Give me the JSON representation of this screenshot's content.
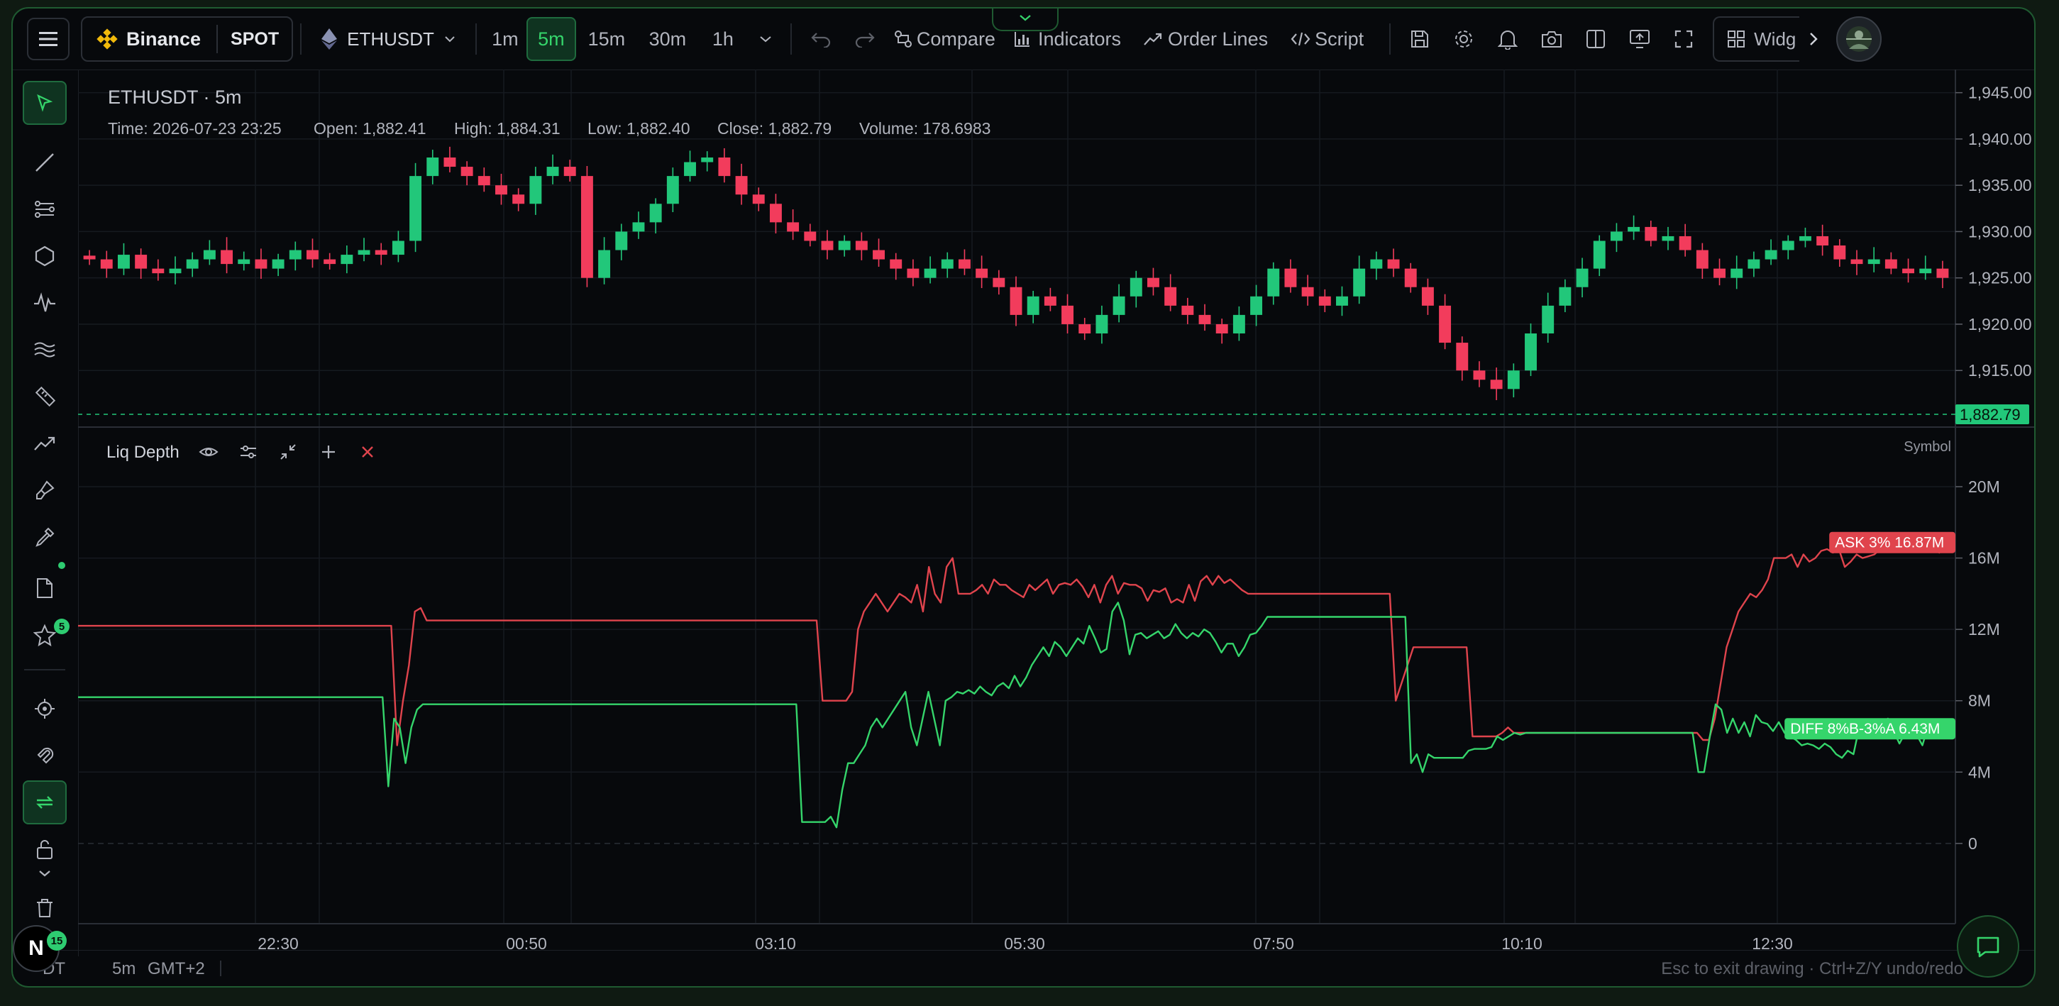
{
  "topbar": {
    "exchange": "Binance",
    "market": "SPOT",
    "symbol": "ETHUSDT",
    "timeframes": [
      "1m",
      "5m",
      "15m",
      "30m",
      "1h"
    ],
    "active_timeframe": "5m",
    "compare": "Compare",
    "indicators": "Indicators",
    "order_lines": "Order Lines",
    "script": "Script",
    "widgets": "Widg"
  },
  "legend": {
    "title": "ETHUSDT · 5m",
    "time": "Time: 2026-07-23 23:25",
    "open": "Open: 1,882.41",
    "high": "High: 1,884.31",
    "low": "Low: 1,882.40",
    "close": "Close: 1,882.79",
    "volume": "Volume: 178.6983"
  },
  "indicator": {
    "name": "Liq Depth",
    "symbol_label": "Symbol"
  },
  "left_toolbar": {
    "favorites_badge": "5",
    "notifications_badge": "15",
    "user_initial": "N"
  },
  "status": {
    "symbol_fragment": "DT",
    "interval": "5m",
    "timezone": "GMT+2",
    "hint": "Esc to exit drawing · Ctrl+Z/Y undo/redo"
  },
  "colors": {
    "up": "#22c77a",
    "down": "#f23c5c",
    "ask": "#e0444d",
    "diff": "#35d56b",
    "accent": "#2ecc71"
  },
  "chart_data": [
    {
      "type": "candlestick",
      "title": "ETHUSDT · 5m",
      "y_axis_ticks": [
        "1,945.00",
        "1,940.00",
        "1,935.00",
        "1,930.00",
        "1,925.00",
        "1,920.00",
        "1,915.00"
      ],
      "ylim": [
        1909.5,
        1947.5
      ],
      "x_ticks": [
        "22:30",
        "00:50",
        "03:10",
        "05:30",
        "07:50",
        "10:10",
        "12:30"
      ],
      "last_price": 1882.79,
      "last_price_label": "1,882.79",
      "close_path": [
        1927,
        1926,
        1927.5,
        1926,
        1925.5,
        1926,
        1927,
        1928,
        1926.5,
        1927,
        1926,
        1927,
        1928,
        1927,
        1926.5,
        1927.5,
        1928,
        1927.5,
        1929,
        1936,
        1938,
        1937,
        1936,
        1935,
        1934,
        1933,
        1936,
        1937,
        1936,
        1925,
        1928,
        1930,
        1931,
        1933,
        1936,
        1937.5,
        1938,
        1936,
        1934,
        1933,
        1931,
        1930,
        1929,
        1928,
        1929,
        1928,
        1927,
        1926,
        1925,
        1926,
        1927,
        1926,
        1925,
        1924,
        1921,
        1923,
        1922,
        1920,
        1919,
        1921,
        1923,
        1925,
        1924,
        1922,
        1921,
        1920,
        1919,
        1921,
        1923,
        1926,
        1924,
        1923,
        1922,
        1923,
        1926,
        1927,
        1926,
        1924,
        1922,
        1918,
        1915,
        1914,
        1913,
        1915,
        1919,
        1922,
        1924,
        1926,
        1929,
        1930,
        1930.5,
        1929,
        1929.5,
        1928,
        1926,
        1925,
        1926,
        1927,
        1928,
        1929,
        1929.5,
        1928.5,
        1927,
        1926.5,
        1927,
        1926,
        1925.5,
        1926,
        1925
      ]
    },
    {
      "type": "line",
      "title": "Liq Depth",
      "y_axis_ticks": [
        "20M",
        "16M",
        "12M",
        "8M",
        "4M",
        "0"
      ],
      "ylim": [
        -4.5,
        23.5
      ],
      "series": [
        {
          "name": "ASK 3%",
          "last_value_label": "ASK 3% 16.87M",
          "values": [
            12.2,
            12.2,
            12.2,
            12.2,
            12.2,
            12.2,
            12.2,
            12.2,
            12.2,
            12.2,
            12.2,
            12.2,
            12.2,
            12.2,
            12.2,
            12.2,
            12.2,
            12.2,
            12.2,
            12.2,
            12.2,
            12.2,
            12.2,
            12.2,
            12.2,
            12.2,
            12.2,
            12.2,
            12.2,
            12.2,
            12.2,
            12.2,
            12.2,
            12.2,
            12.2,
            12.2,
            12.2,
            12.2,
            12.2,
            12.2,
            12.2,
            12.2,
            12.2,
            12.2,
            12.2,
            12.2,
            12.2,
            12.2,
            12.2,
            12.2,
            12.2,
            12.2,
            12.2,
            12.2,
            5.5,
            8,
            10,
            13,
            13.2,
            12.5,
            12.5,
            12.5,
            12.5,
            12.5,
            12.5,
            12.5,
            12.5,
            12.5,
            12.5,
            12.5,
            12.5,
            12.5,
            12.5,
            12.5,
            12.5,
            12.5,
            12.5,
            12.5,
            12.5,
            12.5,
            12.5,
            12.5,
            12.5,
            12.5,
            12.5,
            12.5,
            12.5,
            12.5,
            12.5,
            12.5,
            12.5,
            12.5,
            12.5,
            12.5,
            12.5,
            12.5,
            12.5,
            12.5,
            12.5,
            12.5,
            12.5,
            12.5,
            12.5,
            12.5,
            12.5,
            12.5,
            12.5,
            12.5,
            12.5,
            12.5,
            12.5,
            12.5,
            12.5,
            12.5,
            12.5,
            12.5,
            12.5,
            12.5,
            12.5,
            12.5,
            12.5,
            12.5,
            12.5,
            12.5,
            12.5,
            12.5,
            8,
            8,
            8,
            8,
            8,
            8.5,
            12,
            13,
            13.5,
            14,
            13.5,
            13,
            13.5,
            14,
            13.8,
            13.5,
            14.5,
            13,
            15.5,
            14,
            13.5,
            15.5,
            16,
            14,
            14,
            14,
            14.2,
            14.5,
            14,
            14.8,
            14.5,
            14.5,
            14.2,
            14,
            13.8,
            14.5,
            14.2,
            14.5,
            14.8,
            14,
            14.5,
            14.6,
            14.5,
            14.8,
            14.4,
            13.8,
            14.5,
            13.5,
            14.5,
            15,
            14,
            14.6,
            14.5,
            14.5,
            14.3,
            13.6,
            14.2,
            14.1,
            14.3,
            13.5,
            13.7,
            13.5,
            14.5,
            13.6,
            14.7,
            15,
            14.5,
            15,
            14.6,
            14.8,
            14.5,
            14.2,
            14,
            14,
            14,
            14,
            14,
            14,
            14,
            14,
            14,
            14,
            14,
            14,
            14,
            14,
            14,
            14,
            14,
            14,
            14,
            14,
            14,
            14,
            14,
            14,
            14,
            8,
            9,
            10,
            11,
            11,
            11,
            11,
            11,
            11,
            11,
            11,
            11,
            11,
            6,
            6,
            6,
            6,
            6,
            6.2,
            6.5,
            6.2,
            6.2,
            6.2,
            6.2,
            6.2,
            6.2,
            6.2,
            6.2,
            6.2,
            6.2,
            6.2,
            6.2,
            6.2,
            6.2,
            6.2,
            6.2,
            6.2,
            6.2,
            6.2,
            6.2,
            6.2,
            6.2,
            6.2,
            6.2,
            6.2,
            6.2,
            6.2,
            6.2,
            6.2,
            6.2,
            6.2,
            6.2,
            5.8,
            5.8,
            7,
            9,
            11,
            12,
            13,
            13.5,
            14,
            13.8,
            14.2,
            14.8,
            16,
            16,
            16,
            16.2,
            15.5,
            16.2,
            15.8,
            16,
            16.4,
            16.5,
            16.3,
            16.5,
            15.5,
            15.8,
            16.2,
            16,
            16.1,
            16.2,
            16.5,
            16.8,
            16.9,
            16.7,
            16.5,
            16.8,
            16.7,
            16.6,
            16.9,
            16.5,
            16.3,
            16.8,
            16.87
          ]
        },
        {
          "name": "DIFF 8%B-3%A",
          "last_value_label": "DIFF 8%B-3%A 6.43M",
          "values": [
            8.2,
            8.2,
            8.2,
            8.2,
            8.2,
            8.2,
            8.2,
            8.2,
            8.2,
            8.2,
            8.2,
            8.2,
            8.2,
            8.2,
            8.2,
            8.2,
            8.2,
            8.2,
            8.2,
            8.2,
            8.2,
            8.2,
            8.2,
            8.2,
            8.2,
            8.2,
            8.2,
            8.2,
            8.2,
            8.2,
            8.2,
            8.2,
            8.2,
            8.2,
            8.2,
            8.2,
            8.2,
            8.2,
            8.2,
            8.2,
            8.2,
            8.2,
            8.2,
            8.2,
            8.2,
            8.2,
            8.2,
            8.2,
            8.2,
            8.2,
            8.2,
            8.2,
            8.2,
            8.2,
            3.2,
            7,
            6.5,
            4.5,
            6.5,
            7.5,
            7.8,
            7.8,
            7.8,
            7.8,
            7.8,
            7.8,
            7.8,
            7.8,
            7.8,
            7.8,
            7.8,
            7.8,
            7.8,
            7.8,
            7.8,
            7.8,
            7.8,
            7.8,
            7.8,
            7.8,
            7.8,
            7.8,
            7.8,
            7.8,
            7.8,
            7.8,
            7.8,
            7.8,
            7.8,
            7.8,
            7.8,
            7.8,
            7.8,
            7.8,
            7.8,
            7.8,
            7.8,
            7.8,
            7.8,
            7.8,
            7.8,
            7.8,
            7.8,
            7.8,
            7.8,
            7.8,
            7.8,
            7.8,
            7.8,
            7.8,
            7.8,
            7.8,
            7.8,
            7.8,
            7.8,
            7.8,
            7.8,
            7.8,
            7.8,
            7.8,
            7.8,
            7.8,
            7.8,
            7.8,
            7.8,
            7.8,
            1.2,
            1.2,
            1.2,
            1.2,
            1.2,
            1.5,
            0.9,
            3,
            4.5,
            4.5,
            5,
            5.5,
            6.5,
            7,
            6.5,
            7,
            7.5,
            8,
            8.5,
            6.5,
            5.5,
            7,
            8.5,
            7,
            5.5,
            8,
            8.2,
            8.5,
            8.4,
            8.6,
            8.4,
            8.8,
            8.5,
            8.3,
            8.8,
            9,
            8.7,
            9.4,
            8.8,
            9.3,
            10,
            10.5,
            11,
            10.5,
            11.3,
            11,
            10.5,
            11,
            11.5,
            11.2,
            12.2,
            11.5,
            10.7,
            10.9,
            13,
            13.5,
            12.5,
            10.6,
            11.7,
            11.8,
            11.5,
            11.7,
            11.9,
            11.5,
            11.7,
            12.3,
            11.8,
            11.5,
            11.8,
            11.6,
            12,
            11.8,
            11.3,
            10.7,
            11.2,
            11.2,
            10.5,
            11,
            11.7,
            11.8,
            12.2,
            12.7,
            12.7,
            12.7,
            12.7,
            12.7,
            12.7,
            12.7,
            12.7,
            12.7,
            12.7,
            12.7,
            12.7,
            12.7,
            12.7,
            12.7,
            12.7,
            12.7,
            12.7,
            12.7,
            12.7,
            12.7,
            12.7,
            12.7,
            12.7,
            12.7,
            4.5,
            5,
            4,
            5,
            4.8,
            4.8,
            4.8,
            4.8,
            4.8,
            4.8,
            5.2,
            5.3,
            5.3,
            5.3,
            5.4,
            6,
            5.8,
            6,
            6.2,
            6.1,
            6.2,
            6.2,
            6.2,
            6.2,
            6.2,
            6.2,
            6.2,
            6.2,
            6.2,
            6.2,
            6.2,
            6.2,
            6.2,
            6.2,
            6.2,
            6.2,
            6.2,
            6.2,
            6.2,
            6.2,
            6.2,
            6.2,
            6.2,
            6.2,
            6.2,
            6.2,
            6.2,
            6.2,
            6.2,
            6.2,
            4,
            4,
            6,
            7.8,
            7.5,
            6.2,
            7,
            6.2,
            6.8,
            6,
            7.2,
            6.8,
            6.7,
            6.3,
            6.8,
            6.2,
            6,
            5.8,
            5.5,
            5.6,
            5.5,
            5.3,
            5.6,
            5.4,
            5,
            4.8,
            5.2,
            5,
            6.5,
            6.4,
            5.9,
            6.2,
            6.7,
            7,
            6.3,
            5.6,
            6.2,
            6,
            6.1,
            5.5,
            6.6,
            6.3,
            6.5,
            6.4,
            6.43
          ]
        }
      ]
    }
  ]
}
